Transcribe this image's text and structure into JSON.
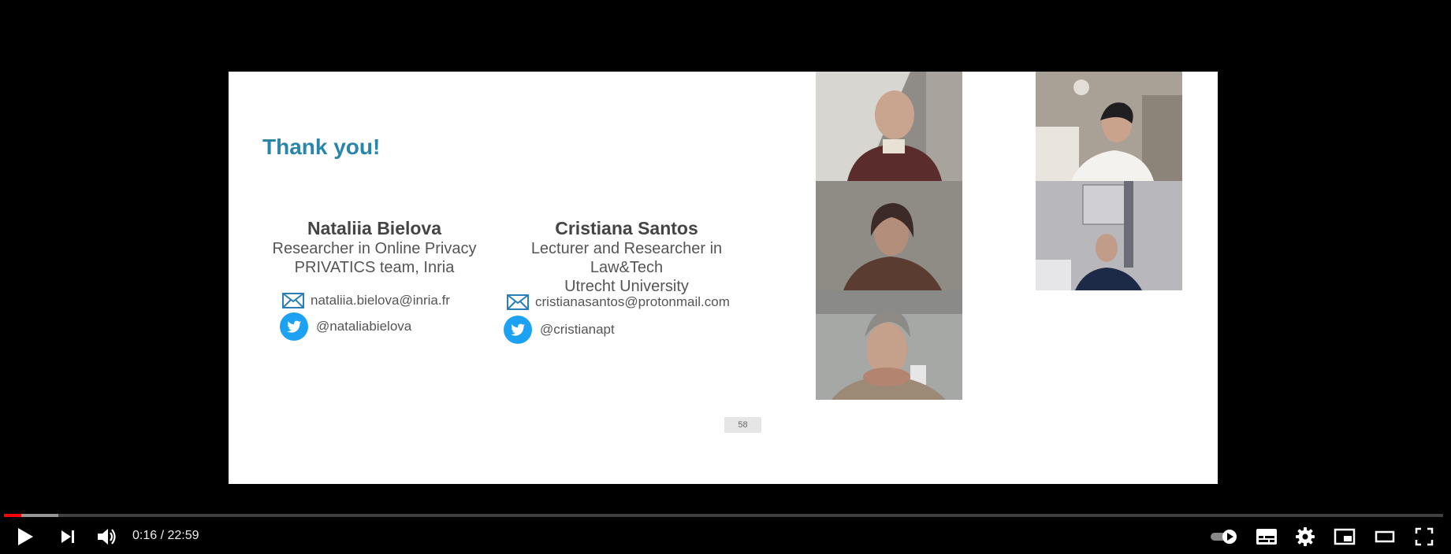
{
  "slide": {
    "title": "Thank you!",
    "slide_number": "58",
    "authors": [
      {
        "name": "Nataliia Bielova",
        "role": "Researcher in Online Privacy",
        "affiliation": "PRIVATICS team, Inria",
        "email": "nataliia.bielova@inria.fr",
        "twitter": "@nataliabielova"
      },
      {
        "name": "Cristiana Santos",
        "role": "Lecturer and Researcher in Law&Tech",
        "affiliation": "Utrecht University",
        "email": "cristianasantos@protonmail.com",
        "twitter": "@cristianapt"
      }
    ]
  },
  "participants": [
    "participant-1",
    "participant-2",
    "participant-3",
    "participant-4",
    "participant-5"
  ],
  "player": {
    "current_time": "0:16",
    "separator": " / ",
    "duration": "22:59",
    "played_fraction": 0.012,
    "buffered_fraction": 0.038,
    "accent_color": "#ff0000",
    "icons": [
      "play-icon",
      "next-icon",
      "volume-icon",
      "autoplay-toggle-icon",
      "subtitles-icon",
      "settings-icon",
      "miniplayer-icon",
      "theater-mode-icon",
      "fullscreen-icon"
    ]
  }
}
